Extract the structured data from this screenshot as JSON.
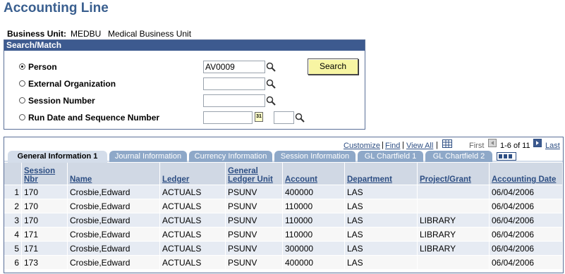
{
  "page": {
    "title": "Accounting Line"
  },
  "business_unit": {
    "label": "Business Unit:",
    "code": "MEDBU",
    "description": "Medical Business Unit"
  },
  "search_match": {
    "header": "Search/Match",
    "options": [
      {
        "label": "Person",
        "selected": true
      },
      {
        "label": "External Organization",
        "selected": false
      },
      {
        "label": "Session Number",
        "selected": false
      },
      {
        "label": "Run Date and Sequence Number",
        "selected": false
      }
    ],
    "fields": {
      "person_value": "AV0009",
      "ext_org_value": "",
      "session_value": "",
      "run_date_value": "",
      "sequence_value": ""
    },
    "search_button": "Search",
    "calendar_icon_text": "31"
  },
  "grid": {
    "nav": {
      "customize": "Customize",
      "find": "Find",
      "view_all": "View All",
      "sep": "|",
      "first": "First",
      "range": "1-6 of 11",
      "last": "Last"
    },
    "tabs": [
      "General Information 1",
      "Journal Information",
      "Currency Information",
      "Session Information",
      "GL Chartfield 1",
      "GL Chartfield 2"
    ],
    "columns": [
      "Session Nbr",
      "Name",
      "Ledger",
      "General Ledger Unit",
      "Account",
      "Department",
      "Project/Grant",
      "Accounting Date"
    ],
    "rows": [
      [
        "1",
        "170",
        "Crosbie,Edward",
        "ACTUALS",
        "PSUNV",
        "400000",
        "LAS",
        "",
        "06/04/2006"
      ],
      [
        "2",
        "170",
        "Crosbie,Edward",
        "ACTUALS",
        "PSUNV",
        "110000",
        "LAS",
        "",
        "06/04/2006"
      ],
      [
        "3",
        "170",
        "Crosbie,Edward",
        "ACTUALS",
        "PSUNV",
        "110000",
        "LAS",
        "LIBRARY",
        "06/04/2006"
      ],
      [
        "4",
        "171",
        "Crosbie,Edward",
        "ACTUALS",
        "PSUNV",
        "110000",
        "LAS",
        "LIBRARY",
        "06/04/2006"
      ],
      [
        "5",
        "171",
        "Crosbie,Edward",
        "ACTUALS",
        "PSUNV",
        "300000",
        "LAS",
        "LIBRARY",
        "06/04/2006"
      ],
      [
        "6",
        "173",
        "Crosbie,Edward",
        "ACTUALS",
        "PSUNV",
        "400000",
        "LAS",
        "",
        "06/04/2006"
      ]
    ]
  }
}
